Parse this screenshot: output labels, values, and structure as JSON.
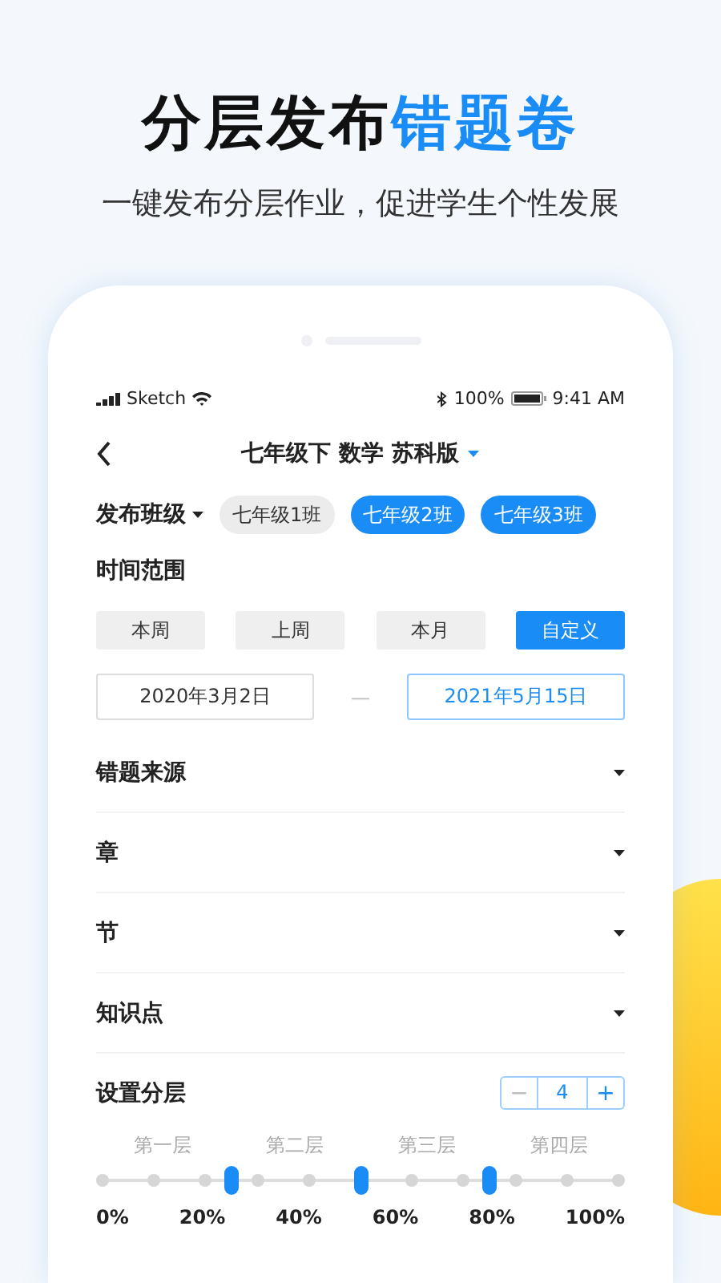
{
  "headline": {
    "dark": "分层发布",
    "accent": "错题卷"
  },
  "subtitle": "一键发布分层作业，促进学生个性发展",
  "status_bar": {
    "carrier": "Sketch",
    "battery": "100%",
    "time": "9:41 AM"
  },
  "nav": {
    "title": "七年级下 数学 苏科版"
  },
  "classes": {
    "label": "发布班级",
    "items": [
      {
        "label": "七年级1班",
        "selected": false
      },
      {
        "label": "七年级2班",
        "selected": true
      },
      {
        "label": "七年级3班",
        "selected": true
      }
    ]
  },
  "time_range": {
    "label": "时间范围",
    "options": [
      {
        "label": "本周",
        "selected": false
      },
      {
        "label": "上周",
        "selected": false
      },
      {
        "label": "本月",
        "selected": false
      },
      {
        "label": "自定义",
        "selected": true
      }
    ],
    "start": {
      "value": "2020年3月2日",
      "selected": false
    },
    "separator": "—",
    "end": {
      "value": "2021年5月15日",
      "selected": true
    }
  },
  "filters": [
    {
      "label": "错题来源"
    },
    {
      "label": "章"
    },
    {
      "label": "节"
    },
    {
      "label": "知识点"
    }
  ],
  "layering": {
    "label": "设置分层",
    "minus": "−",
    "count": "4",
    "plus": "+",
    "layers": [
      "第一层",
      "第二层",
      "第三层",
      "第四层"
    ],
    "dividers": [
      {
        "level": 0.25
      },
      {
        "level": 0.5
      },
      {
        "level": 0.75
      }
    ],
    "ticks": [
      "0%",
      "20%",
      "40%",
      "60%",
      "80%",
      "100%"
    ]
  }
}
